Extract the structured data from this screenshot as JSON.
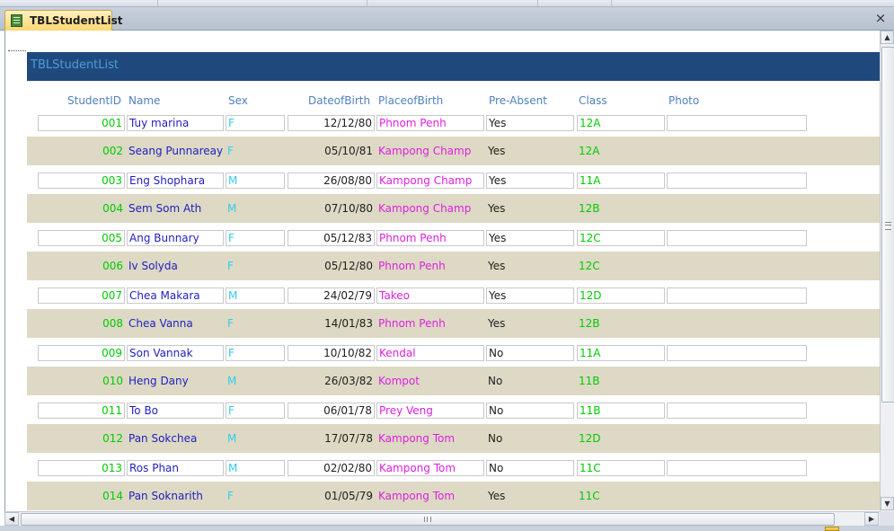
{
  "window": {
    "tab_title": "TBLStudentList",
    "close_glyph": "×"
  },
  "form": {
    "header_title": "TBLStudentList",
    "columns": {
      "id": "StudentID",
      "name": "Name",
      "sex": "Sex",
      "dob": "DateofBirth",
      "pob": "PlaceofBirth",
      "absent": "Pre-Absent",
      "class": "Class",
      "photo": "Photo"
    },
    "rows": [
      {
        "id": "001",
        "name": "Tuy marina",
        "sex": "F",
        "dob": "12/12/80",
        "pob": "Phnom Penh",
        "absent": "Yes",
        "class": "12A"
      },
      {
        "id": "002",
        "name": "Seang Punnareay",
        "sex": "F",
        "dob": "05/10/81",
        "pob": "Kampong Champ",
        "absent": "Yes",
        "class": "12A"
      },
      {
        "id": "003",
        "name": "Eng Shophara",
        "sex": "M",
        "dob": "26/08/80",
        "pob": "Kampong Champ",
        "absent": "Yes",
        "class": "11A"
      },
      {
        "id": "004",
        "name": "Sem Som Ath",
        "sex": "M",
        "dob": "07/10/80",
        "pob": "Kampong Champ",
        "absent": "Yes",
        "class": "12B"
      },
      {
        "id": "005",
        "name": "Ang Bunnary",
        "sex": "F",
        "dob": "05/12/83",
        "pob": "Phnom Penh",
        "absent": "Yes",
        "class": "12C"
      },
      {
        "id": "006",
        "name": "Iv Solyda",
        "sex": "F",
        "dob": "05/12/80",
        "pob": "Phnom Penh",
        "absent": "Yes",
        "class": "12C"
      },
      {
        "id": "007",
        "name": "Chea Makara",
        "sex": "M",
        "dob": "24/02/79",
        "pob": "Takeo",
        "absent": "Yes",
        "class": "12D"
      },
      {
        "id": "008",
        "name": "Chea Vanna",
        "sex": "F",
        "dob": "14/01/83",
        "pob": "Phnom Penh",
        "absent": "Yes",
        "class": "12B"
      },
      {
        "id": "009",
        "name": "Son Vannak",
        "sex": "F",
        "dob": "10/10/82",
        "pob": "Kendal",
        "absent": "No",
        "class": "11A"
      },
      {
        "id": "010",
        "name": "Heng Dany",
        "sex": "M",
        "dob": "26/03/82",
        "pob": "Kompot",
        "absent": "No",
        "class": "11B"
      },
      {
        "id": "011",
        "name": "To Bo",
        "sex": "F",
        "dob": "06/01/78",
        "pob": "Prey Veng",
        "absent": "No",
        "class": "11B"
      },
      {
        "id": "012",
        "name": "Pan Sokchea",
        "sex": "M",
        "dob": "17/07/78",
        "pob": "Kampong Tom",
        "absent": "No",
        "class": "12D"
      },
      {
        "id": "013",
        "name": "Ros Phan",
        "sex": "M",
        "dob": "02/02/80",
        "pob": "Kampong Tom",
        "absent": "No",
        "class": "11C"
      },
      {
        "id": "014",
        "name": "Pan Soknarith",
        "sex": "F",
        "dob": "01/05/79",
        "pob": "Kampong Tom",
        "absent": "Yes",
        "class": "11C"
      }
    ]
  },
  "icons": {
    "tab_icon": "table-icon",
    "close": "close-icon",
    "scroll_up": "arrow-up-icon",
    "scroll_down": "arrow-down-icon",
    "scroll_left": "arrow-left-icon",
    "scroll_right": "arrow-right-icon"
  },
  "colors": {
    "header_bar": "#1f497d",
    "header_text": "#4f9ad6",
    "column_header": "#4f81bd",
    "alt_row": "#ddd9c4",
    "tab_active": "#fcd671",
    "id_text": "#00cc00",
    "name_text": "#1f1fbf",
    "sex_text": "#33ccee",
    "place_text": "#e020e0",
    "class_text": "#00cc00"
  }
}
